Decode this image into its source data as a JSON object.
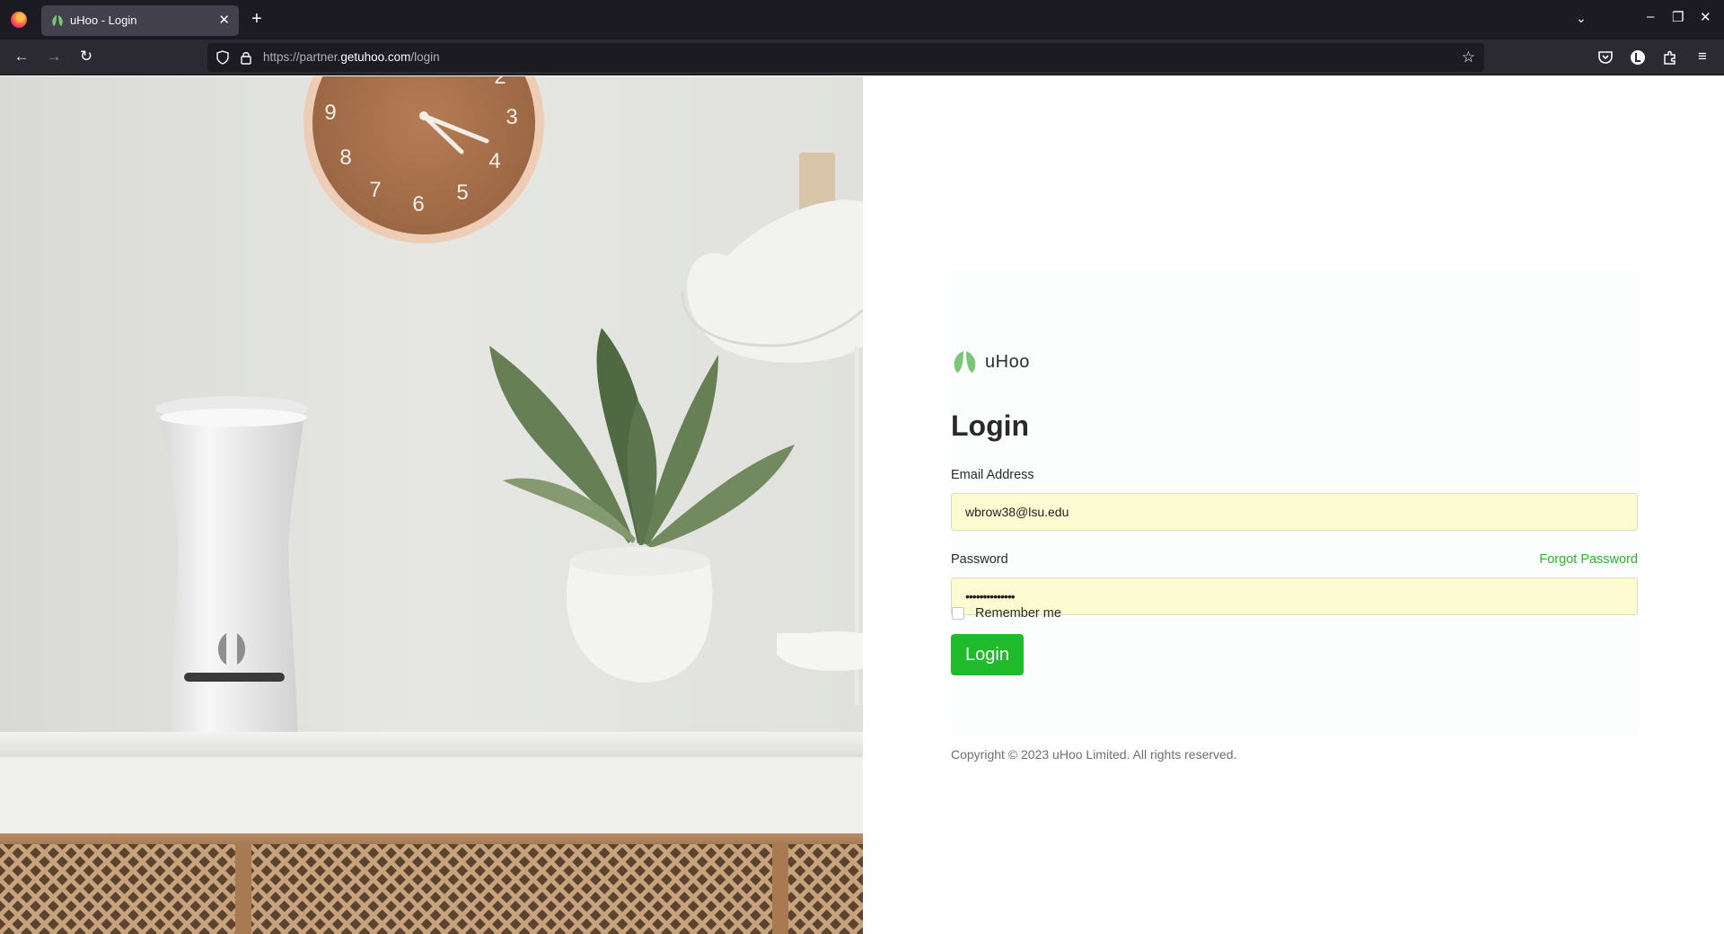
{
  "browser": {
    "tab_title": "uHoo - Login",
    "tab_close": "✕",
    "new_tab": "+",
    "tab_list": "⌄",
    "url_prefix": "https://partner.",
    "url_host": "getuhoo.com",
    "url_path": "/login",
    "back": "←",
    "forward": "→",
    "reload": "↻",
    "bookmark": "☆",
    "minimize": "–",
    "restore": "❐",
    "close": "✕",
    "menu": "≡"
  },
  "logo": {
    "text": "uHoo",
    "color": "#7cc576"
  },
  "login": {
    "heading": "Login",
    "email_label": "Email Address",
    "email_value": "wbrow38@lsu.edu",
    "password_label": "Password",
    "password_value": "••••••••••••••",
    "forgot_password": "Forgot Password",
    "remember_me": "Remember me",
    "remember_checked": false,
    "login_button": "Login",
    "button_color": "#1fbb2a",
    "link_color": "#2bb62b",
    "autofill_color": "#fdfbd2"
  },
  "footer": {
    "copyright": "Copyright © 2023 uHoo Limited. All rights reserved."
  }
}
